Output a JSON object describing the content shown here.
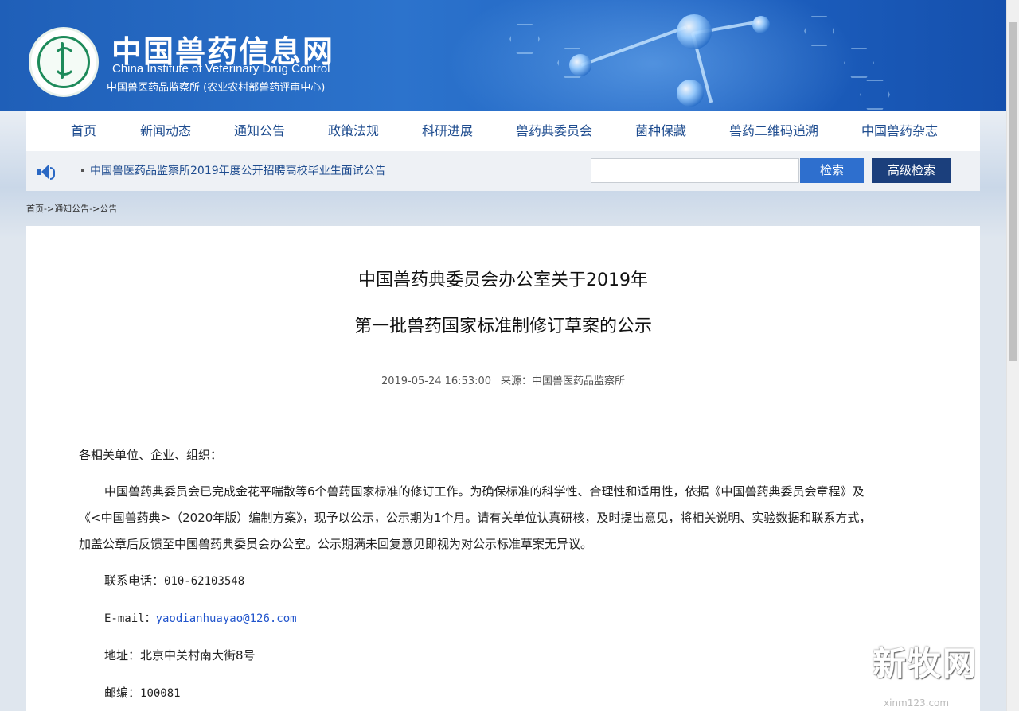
{
  "header": {
    "title": "中国兽药信息网",
    "subtitle_en": "China Institute of Veterinary Drug Control",
    "subtitle_cn": "中国兽医药品监察所 (农业农村部兽药评审中心)"
  },
  "nav": {
    "items": [
      "首页",
      "新闻动态",
      "通知公告",
      "政策法规",
      "科研进展",
      "兽药典委员会",
      "菌种保藏",
      "兽药二维码追溯",
      "中国兽药杂志"
    ]
  },
  "notice": {
    "text": "中国兽医药品监察所2019年度公开招聘高校毕业生面试公告"
  },
  "search": {
    "value": "",
    "button": "检索",
    "advanced": "高级检索"
  },
  "breadcrumb": {
    "home": "首页",
    "sep1": "->",
    "section": "通知公告",
    "sep2": "->",
    "current": "公告"
  },
  "article": {
    "title_line1": "中国兽药典委员会办公室关于2019年",
    "title_line2": "第一批兽药国家标准制修订草案的公示",
    "datetime": "2019-05-24 16:53:00",
    "source": "来源：中国兽医药品监察所",
    "greeting": "各相关单位、企业、组织：",
    "body_line1": "中国兽药典委员会已完成金花平喘散等6个兽药国家标准的修订工作。为确保标准的科学性、合理性和适用性，依据《中国兽药典委员会章程》及",
    "body_line2": "《<中国兽药典>（2020年版）编制方案》，现予以公示，公示期为1个月。请有关单位认真研核，及时提出意见，将相关说明、实验数据和联系方式，",
    "body_line3": "加盖公章后反馈至中国兽药典委员会办公室。公示期满未回复意见即视为对公示标准草案无异议。",
    "phone_label": "联系电话：",
    "phone": "010-62103548",
    "email_label": "E-mail：",
    "email": "yaodianhuayao@126.com",
    "address_label": "地址：",
    "address": "北京中关村南大街8号",
    "postcode_label": "邮编：",
    "postcode": "100081"
  },
  "watermark": {
    "text": "新牧网",
    "url": "xinm123.com"
  },
  "colors": {
    "header_blue": "#1f5fb8",
    "nav_text": "#1e4c8f",
    "search_button": "#2e6fce",
    "advanced_button": "#1b3f7c"
  },
  "icons": [
    "logo-emblem",
    "speaker-icon"
  ]
}
